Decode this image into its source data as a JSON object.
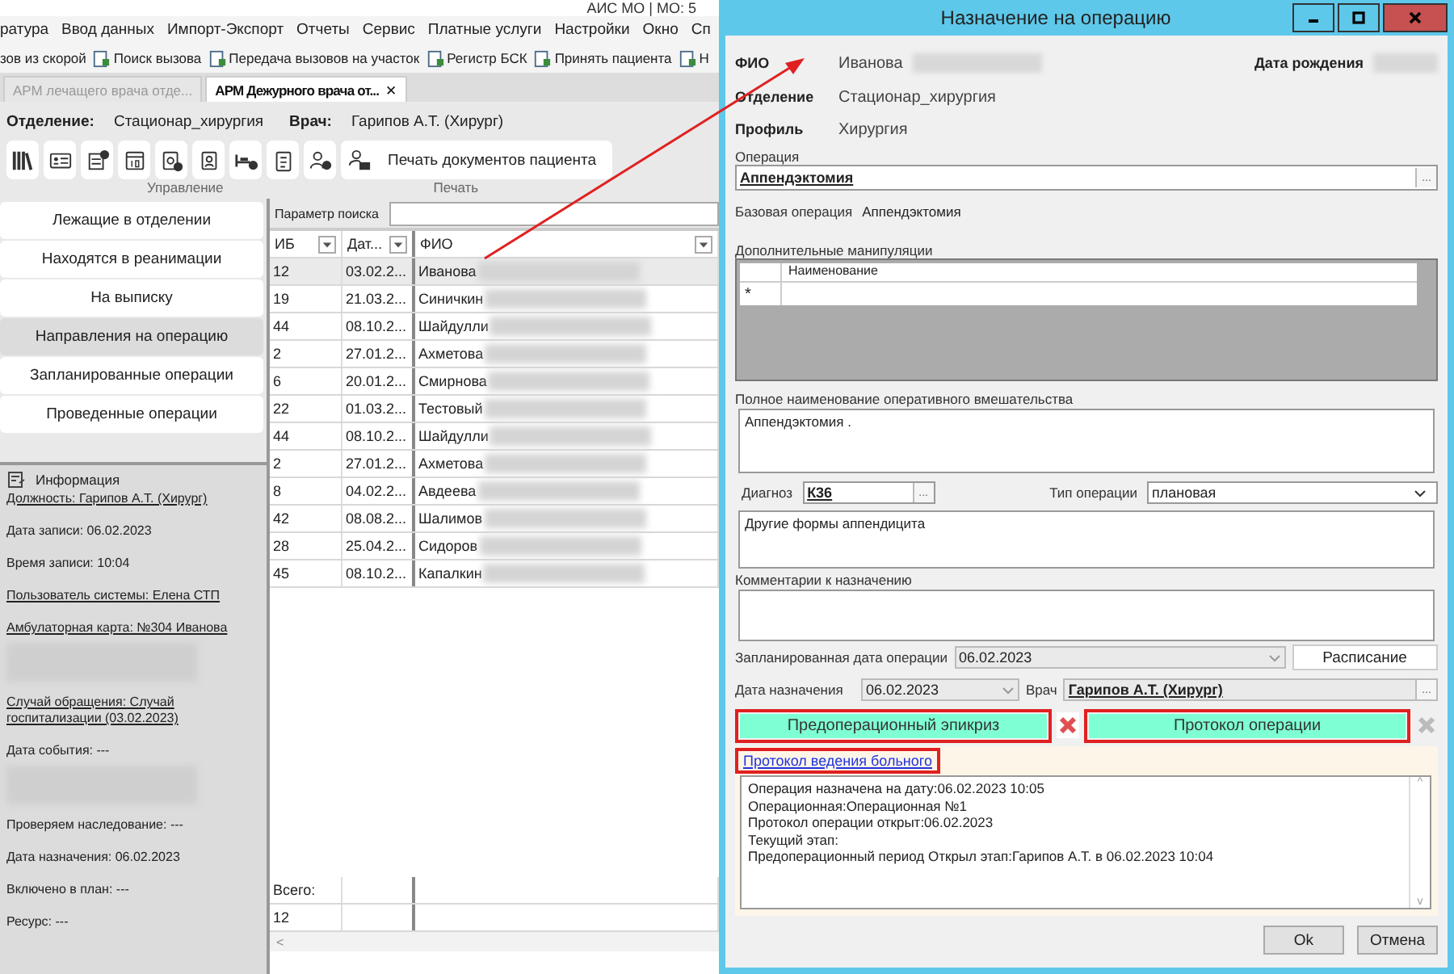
{
  "app": {
    "title": "АИС МО | МО: 5",
    "menu": [
      "ратура",
      "Ввод данных",
      "Импорт-Экспорт",
      "Отчеты",
      "Сервис",
      "Платные услуги",
      "Настройки",
      "Окно",
      "Сп"
    ],
    "toolbar": [
      {
        "label": "зов из скорой",
        "kind": "plain"
      },
      {
        "label": "Поиск вызова",
        "kind": "icon"
      },
      {
        "label": "Передача вызовов на участок",
        "kind": "icon"
      },
      {
        "label": "Регистр БСК",
        "kind": "icon"
      },
      {
        "label": "Принять пациента",
        "kind": "icon"
      },
      {
        "label": "Н",
        "kind": "icon"
      }
    ],
    "tabs": [
      {
        "label": "АРМ лечащего врача отде...",
        "selected": false,
        "closable": false
      },
      {
        "label": "АРМ Дежурного врача от...",
        "selected": true,
        "closable": true
      }
    ],
    "close_glyph": "✕",
    "department_label": "Отделение:",
    "department": "Стационар_хирургия",
    "doctor_label": "Врач:",
    "doctor": "Гарипов А.Т. (Хирург)",
    "print_button": "Печать документов пациента",
    "group_labels": [
      "Управление",
      "Печать"
    ]
  },
  "nav": [
    {
      "label": "Лежащие в отделении",
      "selected": false
    },
    {
      "label": "Находятся в реанимации",
      "selected": false
    },
    {
      "label": "На выписку",
      "selected": false
    },
    {
      "label": "Направления на операцию",
      "selected": true
    },
    {
      "label": "Запланированные операции",
      "selected": false
    },
    {
      "label": "Проведенные операции",
      "selected": false
    }
  ],
  "info": {
    "title": "Информация",
    "lines": [
      {
        "text": "Должность: Гарипов А.Т. (Хирург)",
        "kind": "link"
      },
      {
        "text": "Дата записи: 06.02.2023",
        "kind": "text"
      },
      {
        "text": "Время записи: 10:04",
        "kind": "text"
      },
      {
        "text": "Пользователь системы: Елена  СТП",
        "kind": "link"
      },
      {
        "text": "Амбулаторная карта: №304 Иванова",
        "kind": "link"
      },
      {
        "kind": "blur"
      },
      {
        "text": "Случай обращения: Случай госпитализации (03.02.2023)",
        "kind": "link"
      },
      {
        "text": "Дата события: ---",
        "kind": "tight"
      },
      {
        "kind": "blur"
      },
      {
        "text": "Проверяем наследование: ---",
        "kind": "text"
      },
      {
        "text": "Дата назначения: 06.02.2023",
        "kind": "text"
      },
      {
        "text": "Включено в план: ---",
        "kind": "text"
      },
      {
        "text": "Ресурс: ---",
        "kind": "text"
      }
    ]
  },
  "table": {
    "search_label": "Параметр поиска",
    "columns": [
      "ИБ",
      "Дат...",
      "ФИО"
    ],
    "rows": [
      {
        "ib": "12",
        "date": "03.02.2...",
        "name": "Иванова",
        "selected": true
      },
      {
        "ib": "19",
        "date": "21.03.2...",
        "name": "Синичкин",
        "selected": false
      },
      {
        "ib": "44",
        "date": "08.10.2...",
        "name": "Шайдулли",
        "selected": false
      },
      {
        "ib": "2",
        "date": "27.01.2...",
        "name": "Ахметова",
        "selected": false
      },
      {
        "ib": "6",
        "date": "20.01.2...",
        "name": "Смирнова",
        "selected": false
      },
      {
        "ib": "22",
        "date": "01.03.2...",
        "name": "Тестовый",
        "selected": false
      },
      {
        "ib": "44",
        "date": "08.10.2...",
        "name": "Шайдулли",
        "selected": false
      },
      {
        "ib": "2",
        "date": "27.01.2...",
        "name": "Ахметова",
        "selected": false
      },
      {
        "ib": "8",
        "date": "04.02.2...",
        "name": "Авдеева",
        "selected": false
      },
      {
        "ib": "42",
        "date": "08.08.2...",
        "name": "Шалимов",
        "selected": false
      },
      {
        "ib": "28",
        "date": "25.04.2...",
        "name": "Сидоров",
        "selected": false
      },
      {
        "ib": "45",
        "date": "08.10.2...",
        "name": "Капалкин",
        "selected": false
      }
    ],
    "total_label": "Всего:",
    "total": "12",
    "scroll_glyph": "<"
  },
  "dialog": {
    "title": "Назначение на операцию",
    "fio_label": "ФИО",
    "fio": "Иванова",
    "birth_label": "Дата рождения",
    "department_label": "Отделение",
    "department": "Стационар_хирургия",
    "profile_label": "Профиль",
    "profile": "Хирургия",
    "operation_label": "Операция",
    "operation": "Аппендэктомия",
    "base_label": "Базовая операция",
    "base": "Аппендэктомия",
    "extra_label": "Дополнительные манипуляции",
    "extra_column": "Наименование",
    "new_row_glyph": "*",
    "full_name_label": "Полное наименование оперативного вмешательства",
    "full_name": "Аппендэктомия .",
    "diagnosis_label": "Диагноз",
    "diagnosis_code": "К36",
    "type_label": "Тип операции",
    "type": "плановая",
    "diagnosis_text": "Другие формы аппендицита",
    "comment_label": "Комментарии к назначению",
    "planned_label": "Запланированная дата операции",
    "planned": "06.02.2023",
    "planned_disabled": true,
    "schedule_button": "Расписание",
    "assigned_label": "Дата назначения",
    "assigned": "06.02.2023",
    "doctor_label": "Врач",
    "doctor": "Гарипов А.Т. (Хирург)",
    "epicrisis_button": "Предоперационный эпикриз",
    "protocol_button": "Протокол операции",
    "delete_enabled": [
      true,
      false
    ],
    "log_link": "Протокол ведения больного",
    "log": [
      "Операция назначена на дату:06.02.2023 10:05",
      "Операционная:Операционная №1",
      "Протокол операции открыт:06.02.2023",
      "Текущий этап:",
      "Предоперационный период Открыл этап:Гарипов А.Т. в 06.02.2023 10:04"
    ],
    "ok": "Ok",
    "cancel": "Отмена",
    "ellipsis": "...",
    "scroll_up": "^",
    "scroll_down": "v"
  }
}
